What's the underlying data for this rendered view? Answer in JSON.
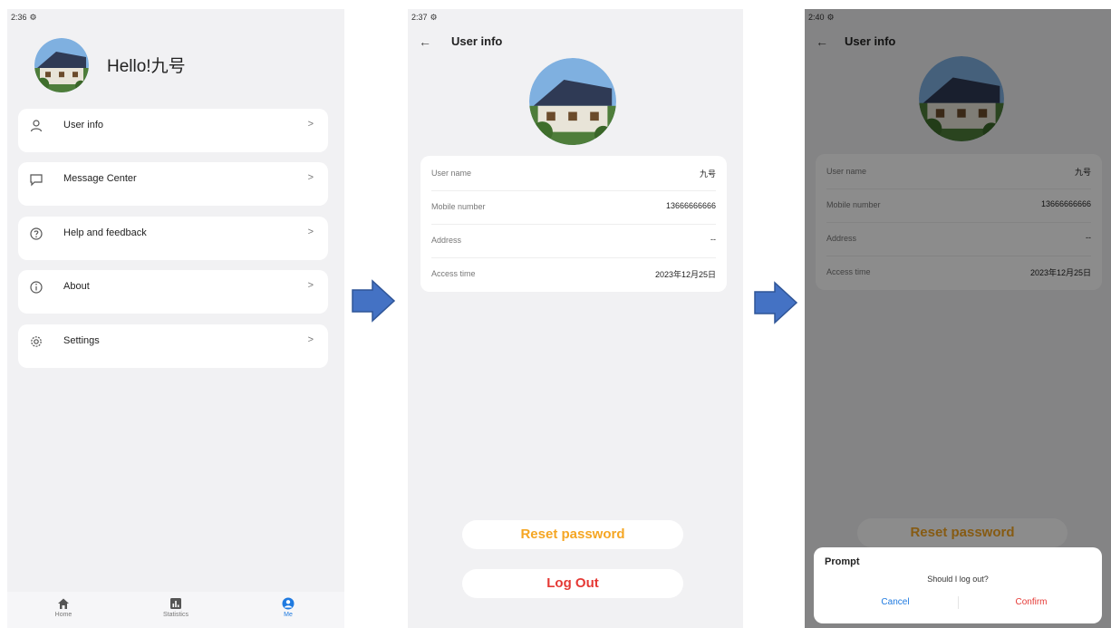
{
  "screen1": {
    "status_time": "2:36",
    "greeting": "Hello!九号",
    "menu": [
      {
        "label": "User info",
        "icon": "user-icon",
        "chevron": ">"
      },
      {
        "label": "Message Center",
        "icon": "message-icon",
        "chevron": ">"
      },
      {
        "label": "Help and feedback",
        "icon": "help-icon",
        "chevron": ">"
      },
      {
        "label": "About",
        "icon": "info-icon",
        "chevron": ">"
      },
      {
        "label": "Settings",
        "icon": "gear-icon",
        "chevron": ">"
      }
    ],
    "tabs": [
      {
        "label": "Home",
        "icon": "home-icon"
      },
      {
        "label": "Statistics",
        "icon": "bar-chart-icon"
      },
      {
        "label": "Me",
        "icon": "person-icon",
        "active": true
      }
    ]
  },
  "screen2": {
    "status_time": "2:37",
    "back": "←",
    "title": "User info",
    "rows": [
      {
        "label": "User name",
        "value": "九号"
      },
      {
        "label": "Mobile number",
        "value": "13666666666"
      },
      {
        "label": "Address",
        "value": "--"
      },
      {
        "label": "Access time",
        "value": "2023年12月25日"
      }
    ],
    "reset_label": "Reset password",
    "logout_label": "Log Out"
  },
  "screen3": {
    "status_time": "2:40",
    "back": "←",
    "title": "User info",
    "rows": [
      {
        "label": "User name",
        "value": "九号"
      },
      {
        "label": "Mobile number",
        "value": "13666666666"
      },
      {
        "label": "Address",
        "value": "--"
      },
      {
        "label": "Access time",
        "value": "2023年12月25日"
      }
    ],
    "reset_label": "Reset password",
    "dialog": {
      "title": "Prompt",
      "message": "Should I log out?",
      "cancel": "Cancel",
      "confirm": "Confirm"
    }
  },
  "colors": {
    "accent_blue": "#1f7ae0",
    "reset_orange": "#f5a623",
    "logout_red": "#e53935",
    "arrow_blue": "#4472c4"
  }
}
